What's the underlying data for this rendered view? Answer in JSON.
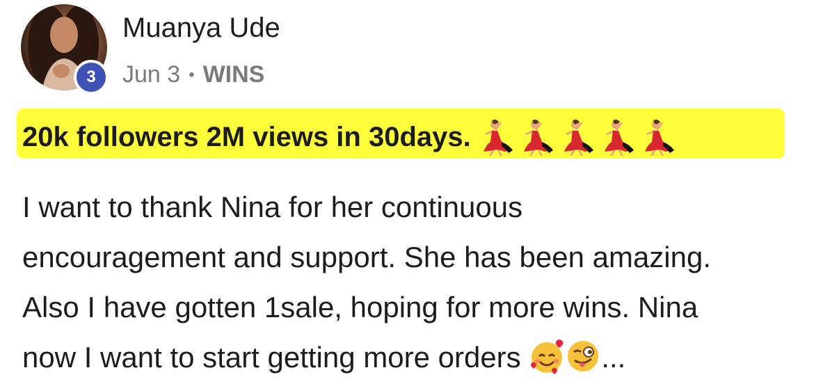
{
  "post": {
    "author_name": "Muanya Ude",
    "badge_count": "3",
    "date": "Jun 3",
    "separator": "•",
    "category": "WINS",
    "headline": "20k followers 2M views in 30days.",
    "headline_emoji": "woman-dancing-icon",
    "body_lines": [
      "I want to thank Nina for her continuous",
      "encouragement and support. She has been amazing.",
      "Also I have gotten 1sale, hoping for more wins. Nina",
      "now I want to start getting more orders"
    ],
    "trailing_emojis": [
      "smiling-face-with-hearts-icon",
      "winking-face-with-tongue-icon"
    ],
    "truncation": "..."
  },
  "colors": {
    "highlight": "#ffff3c",
    "badge": "#3f51b5",
    "text": "#1c1c1c",
    "meta": "#7a7a7a"
  }
}
